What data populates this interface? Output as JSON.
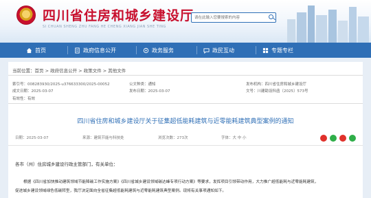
{
  "header": {
    "site_title": "四川省住房和城乡建设厅",
    "site_subtitle": "SI CHUAN SHENG ZHU FANG HE CHENG XIANG JIAN SHE TING",
    "search_placeholder": "请在此输入您要搜索的内容"
  },
  "nav": {
    "items": [
      {
        "label": "首页",
        "icon": "home-icon"
      },
      {
        "label": "政府信息公开",
        "icon": "document-icon"
      },
      {
        "label": "政务服务",
        "icon": "service-icon"
      },
      {
        "label": "政民互动",
        "icon": "chat-icon"
      },
      {
        "label": "专题专栏",
        "icon": "topic-icon"
      }
    ]
  },
  "breadcrumb": {
    "prefix": "当前位置：",
    "items": [
      "首页",
      "政府信息公开",
      "政策文件",
      "其他文件"
    ],
    "separator": " > "
  },
  "meta": {
    "index_no": "索引号：008283930/2025-u376633300/2025-00052",
    "publisher": "公文种类：通知",
    "issuer": "发布机构：四川省住房和城乡建设厅",
    "created": "成文日期：2025-03-07",
    "published": "发布日期：2025-03-07",
    "doc_no": "文号：川建勘设科函〔2025〕573号",
    "validity": "有效性：有效"
  },
  "article": {
    "title": "四川省住房和城乡建设厅关于征集超低能耗建筑与近零能耗建筑典型案例的通知",
    "date": "日期：2025-03-07",
    "source": "来源：建筑节能与科技处",
    "views": "浏览次数：273次",
    "font_size": "字体：大 中 小",
    "greeting": "各市（州）住房城乡建设行政主管部门，有关单位：",
    "paragraph_line1": "根据《四川省加快推动建筑领域节能降碳工作实施方案》《四川省城乡建设领域碳达峰专项行动方案》等要求，发挥项目引领带动作用，大力推广超低能耗与近零能耗建筑，",
    "paragraph_line2": "促进城乡建设领域绿色低碳转型，我厅决定面向全省征集超低能耗建筑与近零能耗建筑典型案例。现将有关事项通知如下。"
  },
  "colors": {
    "brand_red": "#c8102e",
    "nav_blue": "#2f6fb6",
    "share_colors": [
      "#e0312b",
      "#2fae49",
      "#e0312b",
      "#2fae49"
    ]
  }
}
